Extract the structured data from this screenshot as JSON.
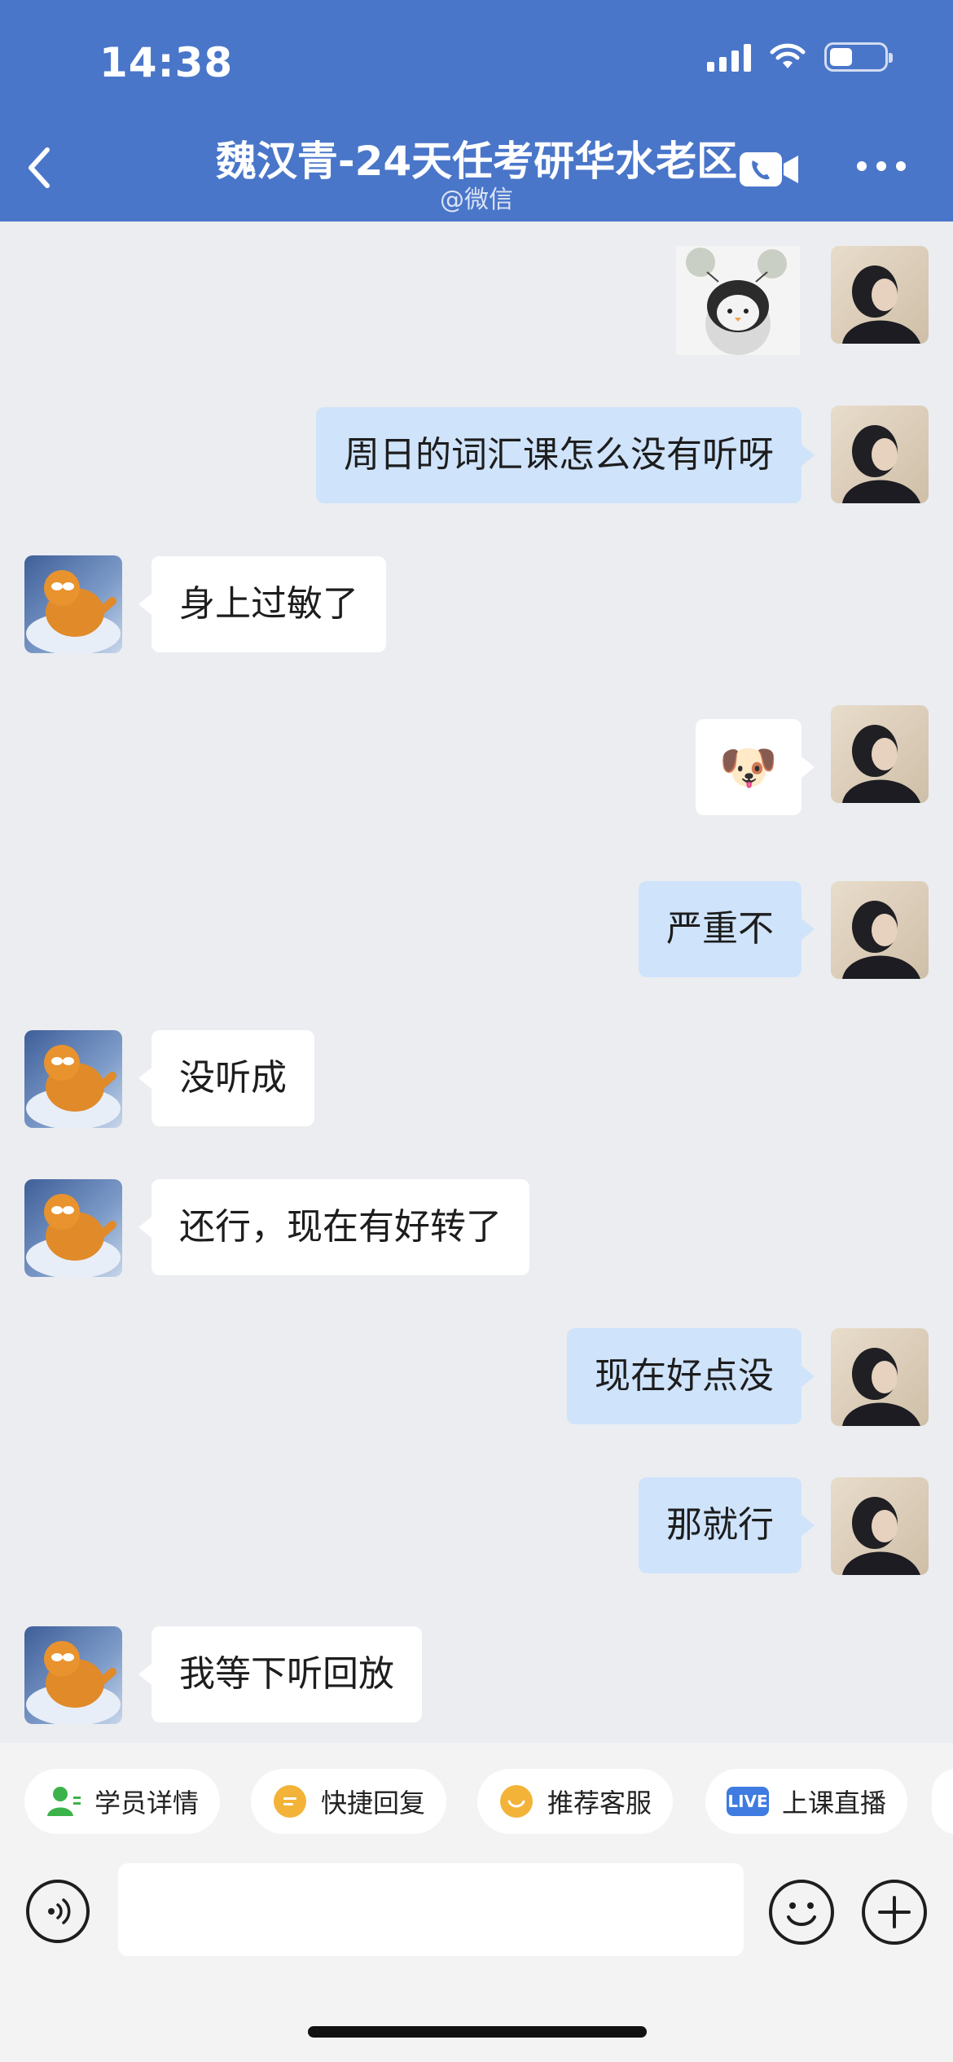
{
  "status_bar": {
    "time": "14:38",
    "battery_level": 0.42
  },
  "header": {
    "title": "魏汉青-24天任考研华水老区",
    "subtitle": "@微信",
    "icons": {
      "back": "chevron-left-icon",
      "call": "video-call-icon",
      "more": "more-dots-icon"
    }
  },
  "messages": [
    {
      "sender": "self",
      "kind": "sticker",
      "content": "penguin-sticker"
    },
    {
      "sender": "self",
      "kind": "text",
      "content": "周日的词汇课怎么没有听呀"
    },
    {
      "sender": "other",
      "kind": "text",
      "content": "身上过敏了"
    },
    {
      "sender": "self",
      "kind": "emoji",
      "content": "🐶"
    },
    {
      "sender": "self",
      "kind": "text",
      "content": "严重不"
    },
    {
      "sender": "other",
      "kind": "text",
      "content": "没听成"
    },
    {
      "sender": "other",
      "kind": "text",
      "content": "还行，现在有好转了"
    },
    {
      "sender": "self",
      "kind": "text",
      "content": "现在好点没"
    },
    {
      "sender": "self",
      "kind": "text",
      "content": "那就行"
    },
    {
      "sender": "other",
      "kind": "text",
      "content": "我等下听回放"
    }
  ],
  "quick_actions": [
    {
      "label": "学员详情",
      "icon": "student-icon",
      "color": "#3bb34a"
    },
    {
      "label": "快捷回复",
      "icon": "quick-reply-icon",
      "color": "#f2b338"
    },
    {
      "label": "推荐客服",
      "icon": "service-icon",
      "color": "#f2b338"
    },
    {
      "label": "上课直播",
      "icon": "live-icon",
      "badge": "LIVE",
      "color": "#3f7be0"
    }
  ],
  "input_bar": {
    "placeholder": "",
    "value": "",
    "icons": {
      "voice": "voice-icon",
      "emoji": "emoji-icon",
      "plus": "plus-icon"
    }
  },
  "colors": {
    "header_bg": "#4a76c9",
    "self_bubble": "#cfe3fb",
    "other_bubble": "#ffffff",
    "chat_bg": "#ebedf0"
  }
}
